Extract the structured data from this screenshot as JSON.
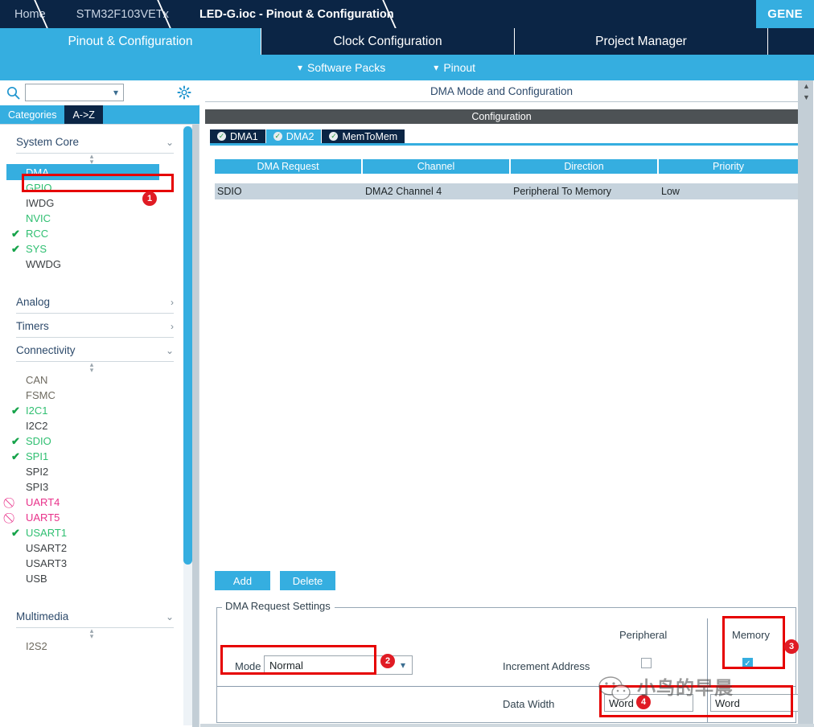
{
  "breadcrumb": {
    "items": [
      {
        "label": "Home",
        "active": false
      },
      {
        "label": "STM32F103VETx",
        "active": false
      },
      {
        "label": "LED-G.ioc - Pinout & Configuration",
        "active": true
      }
    ],
    "generate_button": "GENE"
  },
  "main_tabs": [
    {
      "label": "Pinout & Configuration",
      "selected": true
    },
    {
      "label": "Clock Configuration",
      "selected": false
    },
    {
      "label": "Project Manager",
      "selected": false
    },
    {
      "label": "",
      "selected": false
    }
  ],
  "sub_bar": {
    "items": [
      {
        "label": "Software Packs",
        "icon": "chevron-down-icon"
      },
      {
        "label": "Pinout",
        "icon": "chevron-down-icon"
      }
    ]
  },
  "sidebar": {
    "search": {
      "value": "",
      "placeholder": "",
      "icon": "search-icon"
    },
    "settings_icon": "gear-icon",
    "view_tabs": [
      {
        "label": "Categories",
        "selected": true
      },
      {
        "label": "A->Z",
        "selected": false
      }
    ],
    "groups": [
      {
        "name": "System Core",
        "expanded": true,
        "items": [
          {
            "label": "DMA",
            "state": "selected",
            "mark": ""
          },
          {
            "label": "GPIO",
            "state": "green",
            "mark": ""
          },
          {
            "label": "IWDG",
            "state": "normal",
            "mark": ""
          },
          {
            "label": "NVIC",
            "state": "green",
            "mark": ""
          },
          {
            "label": "RCC",
            "state": "green",
            "mark": "✔"
          },
          {
            "label": "SYS",
            "state": "green",
            "mark": "✔"
          },
          {
            "label": "WWDG",
            "state": "normal",
            "mark": ""
          }
        ]
      },
      {
        "name": "Analog",
        "expanded": false,
        "items": []
      },
      {
        "name": "Timers",
        "expanded": false,
        "items": []
      },
      {
        "name": "Connectivity",
        "expanded": true,
        "items": [
          {
            "label": "CAN",
            "state": "grayb",
            "mark": ""
          },
          {
            "label": "FSMC",
            "state": "grayb",
            "mark": ""
          },
          {
            "label": "I2C1",
            "state": "green",
            "mark": "✔"
          },
          {
            "label": "I2C2",
            "state": "normal",
            "mark": ""
          },
          {
            "label": "SDIO",
            "state": "green",
            "mark": "✔"
          },
          {
            "label": "SPI1",
            "state": "green",
            "mark": "✔"
          },
          {
            "label": "SPI2",
            "state": "normal",
            "mark": ""
          },
          {
            "label": "SPI3",
            "state": "normal",
            "mark": ""
          },
          {
            "label": "UART4",
            "state": "pink",
            "mark": "⃠"
          },
          {
            "label": "UART5",
            "state": "pink",
            "mark": "⃠"
          },
          {
            "label": "USART1",
            "state": "green",
            "mark": "✔"
          },
          {
            "label": "USART2",
            "state": "normal",
            "mark": ""
          },
          {
            "label": "USART3",
            "state": "normal",
            "mark": ""
          },
          {
            "label": "USB",
            "state": "normal",
            "mark": ""
          }
        ]
      },
      {
        "name": "Multimedia",
        "expanded": true,
        "items": [
          {
            "label": "I2S2",
            "state": "grayb",
            "mark": ""
          }
        ]
      }
    ]
  },
  "main": {
    "mode_header": "DMA Mode and Configuration",
    "configuration_bar": "Configuration",
    "dma_tabs": [
      {
        "label": "DMA1",
        "selected": false,
        "icon": "check-circle-icon"
      },
      {
        "label": "DMA2",
        "selected": true,
        "icon": "check-circle-icon"
      },
      {
        "label": "MemToMem",
        "selected": false,
        "icon": "check-circle-icon"
      }
    ],
    "table": {
      "columns": [
        "DMA Request",
        "Channel",
        "Direction",
        "Priority"
      ],
      "rows": [
        [
          "SDIO",
          "DMA2 Channel 4",
          "Peripheral To Memory",
          "Low"
        ]
      ]
    },
    "buttons": {
      "add": "Add",
      "delete": "Delete"
    },
    "request_settings": {
      "legend": "DMA Request Settings",
      "mode_label": "Mode",
      "mode_value": "Normal",
      "col_peripheral": "Peripheral",
      "col_memory": "Memory",
      "increment_label": "Increment Address",
      "increment_peripheral_checked": false,
      "increment_memory_checked": true,
      "data_width_label": "Data Width",
      "data_width_peripheral": "Word",
      "data_width_memory": "Word"
    }
  },
  "annotations": [
    {
      "number": "1",
      "target": "sidebar-dma-item"
    },
    {
      "number": "2",
      "target": "mode-select"
    },
    {
      "number": "3",
      "target": "memory-increment-checkbox"
    },
    {
      "number": "4",
      "target": "data-width-peripheral"
    }
  ],
  "watermark": {
    "text": "小鸟的早晨",
    "icon": "wechat-icon"
  },
  "colors": {
    "accent": "#35aee0",
    "dark_navy": "#0b2545",
    "annotation_red": "#e60000",
    "badge_red": "#e01b24",
    "green": "#2fbf71",
    "pink": "#e8318a"
  }
}
